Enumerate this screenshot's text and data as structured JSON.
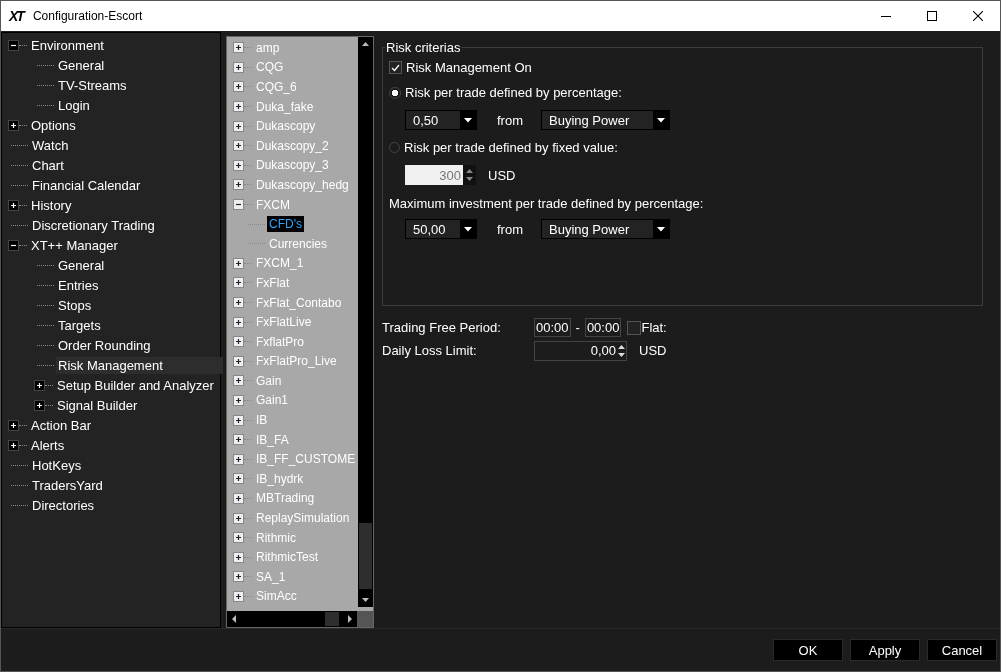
{
  "window": {
    "logo": "XT",
    "title": "Configuration-Escort"
  },
  "nav_tree": [
    {
      "label": "Environment",
      "kind": "folder",
      "expanded": true,
      "selected": false,
      "children": [
        {
          "label": "General",
          "kind": "leaf",
          "selected": false
        },
        {
          "label": "TV-Streams",
          "kind": "leaf",
          "selected": false
        },
        {
          "label": "Login",
          "kind": "leaf",
          "selected": false
        }
      ]
    },
    {
      "label": "Options",
      "kind": "folder",
      "expanded": false,
      "selected": false
    },
    {
      "label": "Watch",
      "kind": "leaf",
      "selected": false
    },
    {
      "label": "Chart",
      "kind": "leaf",
      "selected": false
    },
    {
      "label": "Financial Calendar",
      "kind": "leaf",
      "selected": false
    },
    {
      "label": "History",
      "kind": "folder",
      "expanded": false,
      "selected": false
    },
    {
      "label": "Discretionary Trading",
      "kind": "leaf",
      "selected": false
    },
    {
      "label": "XT++ Manager",
      "kind": "folder",
      "expanded": true,
      "selected": false,
      "children": [
        {
          "label": "General",
          "kind": "leaf",
          "selected": false
        },
        {
          "label": "Entries",
          "kind": "leaf",
          "selected": false
        },
        {
          "label": "Stops",
          "kind": "leaf",
          "selected": false
        },
        {
          "label": "Targets",
          "kind": "leaf",
          "selected": false
        },
        {
          "label": "Order Rounding",
          "kind": "leaf",
          "selected": false
        },
        {
          "label": "Risk Management",
          "kind": "leaf",
          "selected": true
        },
        {
          "label": "Setup Builder and Analyzer",
          "kind": "folder",
          "expanded": false,
          "selected": false
        },
        {
          "label": "Signal Builder",
          "kind": "folder",
          "expanded": false,
          "selected": false
        }
      ]
    },
    {
      "label": "Action Bar",
      "kind": "folder",
      "expanded": false,
      "selected": false
    },
    {
      "label": "Alerts",
      "kind": "folder",
      "expanded": false,
      "selected": false
    },
    {
      "label": "HotKeys",
      "kind": "leaf",
      "selected": false
    },
    {
      "label": "TradersYard",
      "kind": "leaf",
      "selected": false
    },
    {
      "label": "Directories",
      "kind": "leaf",
      "selected": false
    }
  ],
  "connection_tree": [
    {
      "label": "amp",
      "kind": "folder",
      "expanded": false,
      "selected": false
    },
    {
      "label": "CQG",
      "kind": "folder",
      "expanded": false,
      "selected": false
    },
    {
      "label": "CQG_6",
      "kind": "folder",
      "expanded": false,
      "selected": false
    },
    {
      "label": "Duka_fake",
      "kind": "folder",
      "expanded": false,
      "selected": false
    },
    {
      "label": "Dukascopy",
      "kind": "folder",
      "expanded": false,
      "selected": false
    },
    {
      "label": "Dukascopy_2",
      "kind": "folder",
      "expanded": false,
      "selected": false
    },
    {
      "label": "Dukascopy_3",
      "kind": "folder",
      "expanded": false,
      "selected": false
    },
    {
      "label": "Dukascopy_hedg",
      "kind": "folder",
      "expanded": false,
      "selected": false
    },
    {
      "label": "FXCM",
      "kind": "folder",
      "expanded": true,
      "selected": false,
      "children": [
        {
          "label": "CFD's",
          "kind": "leaf",
          "selected": true
        },
        {
          "label": "Currencies",
          "kind": "leaf",
          "selected": false
        }
      ]
    },
    {
      "label": "FXCM_1",
      "kind": "folder",
      "expanded": false,
      "selected": false
    },
    {
      "label": "FxFlat",
      "kind": "folder",
      "expanded": false,
      "selected": false
    },
    {
      "label": "FxFlat_Contabo",
      "kind": "folder",
      "expanded": false,
      "selected": false
    },
    {
      "label": "FxFlatLive",
      "kind": "folder",
      "expanded": false,
      "selected": false
    },
    {
      "label": "FxflatPro",
      "kind": "folder",
      "expanded": false,
      "selected": false
    },
    {
      "label": "FxFlatPro_Live",
      "kind": "folder",
      "expanded": false,
      "selected": false
    },
    {
      "label": "Gain",
      "kind": "folder",
      "expanded": false,
      "selected": false
    },
    {
      "label": "Gain1",
      "kind": "folder",
      "expanded": false,
      "selected": false
    },
    {
      "label": "IB",
      "kind": "folder",
      "expanded": false,
      "selected": false
    },
    {
      "label": "IB_FA",
      "kind": "folder",
      "expanded": false,
      "selected": false
    },
    {
      "label": "IB_FF_CUSTOME",
      "kind": "folder",
      "expanded": false,
      "selected": false
    },
    {
      "label": "IB_hydrk",
      "kind": "folder",
      "expanded": false,
      "selected": false
    },
    {
      "label": "MBTrading",
      "kind": "folder",
      "expanded": false,
      "selected": false
    },
    {
      "label": "ReplaySimulation",
      "kind": "folder",
      "expanded": false,
      "selected": false
    },
    {
      "label": "Rithmic",
      "kind": "folder",
      "expanded": false,
      "selected": false
    },
    {
      "label": "RithmicTest",
      "kind": "folder",
      "expanded": false,
      "selected": false
    },
    {
      "label": "SA_1",
      "kind": "folder",
      "expanded": false,
      "selected": false
    },
    {
      "label": "SimAcc",
      "kind": "folder",
      "expanded": false,
      "selected": false
    }
  ],
  "risk_criteria": {
    "title": "Risk criterias",
    "risk_management_on": {
      "label": "Risk Management On",
      "checked": true
    },
    "percentage_option": {
      "label": "Risk per trade defined by percentage:",
      "selected": true,
      "value": "0,50",
      "from_label": "from",
      "base": "Buying Power"
    },
    "fixed_option": {
      "label": "Risk per trade defined by fixed value:",
      "selected": false,
      "value": "300",
      "unit": "USD",
      "disabled": true
    },
    "max_investment": {
      "label": "Maximum investment per trade defined by percentage:",
      "value": "50,00",
      "from_label": "from",
      "base": "Buying Power"
    }
  },
  "trading_free_period": {
    "label": "Trading Free Period:",
    "start": "00:00",
    "separator": "-",
    "end": "00:00",
    "flat": {
      "label": "Flat:",
      "checked": false
    }
  },
  "daily_loss_limit": {
    "label": "Daily Loss Limit:",
    "value": "0,00",
    "unit": "USD"
  },
  "buttons": [
    {
      "label": "OK"
    },
    {
      "label": "Apply"
    },
    {
      "label": "Cancel"
    }
  ]
}
